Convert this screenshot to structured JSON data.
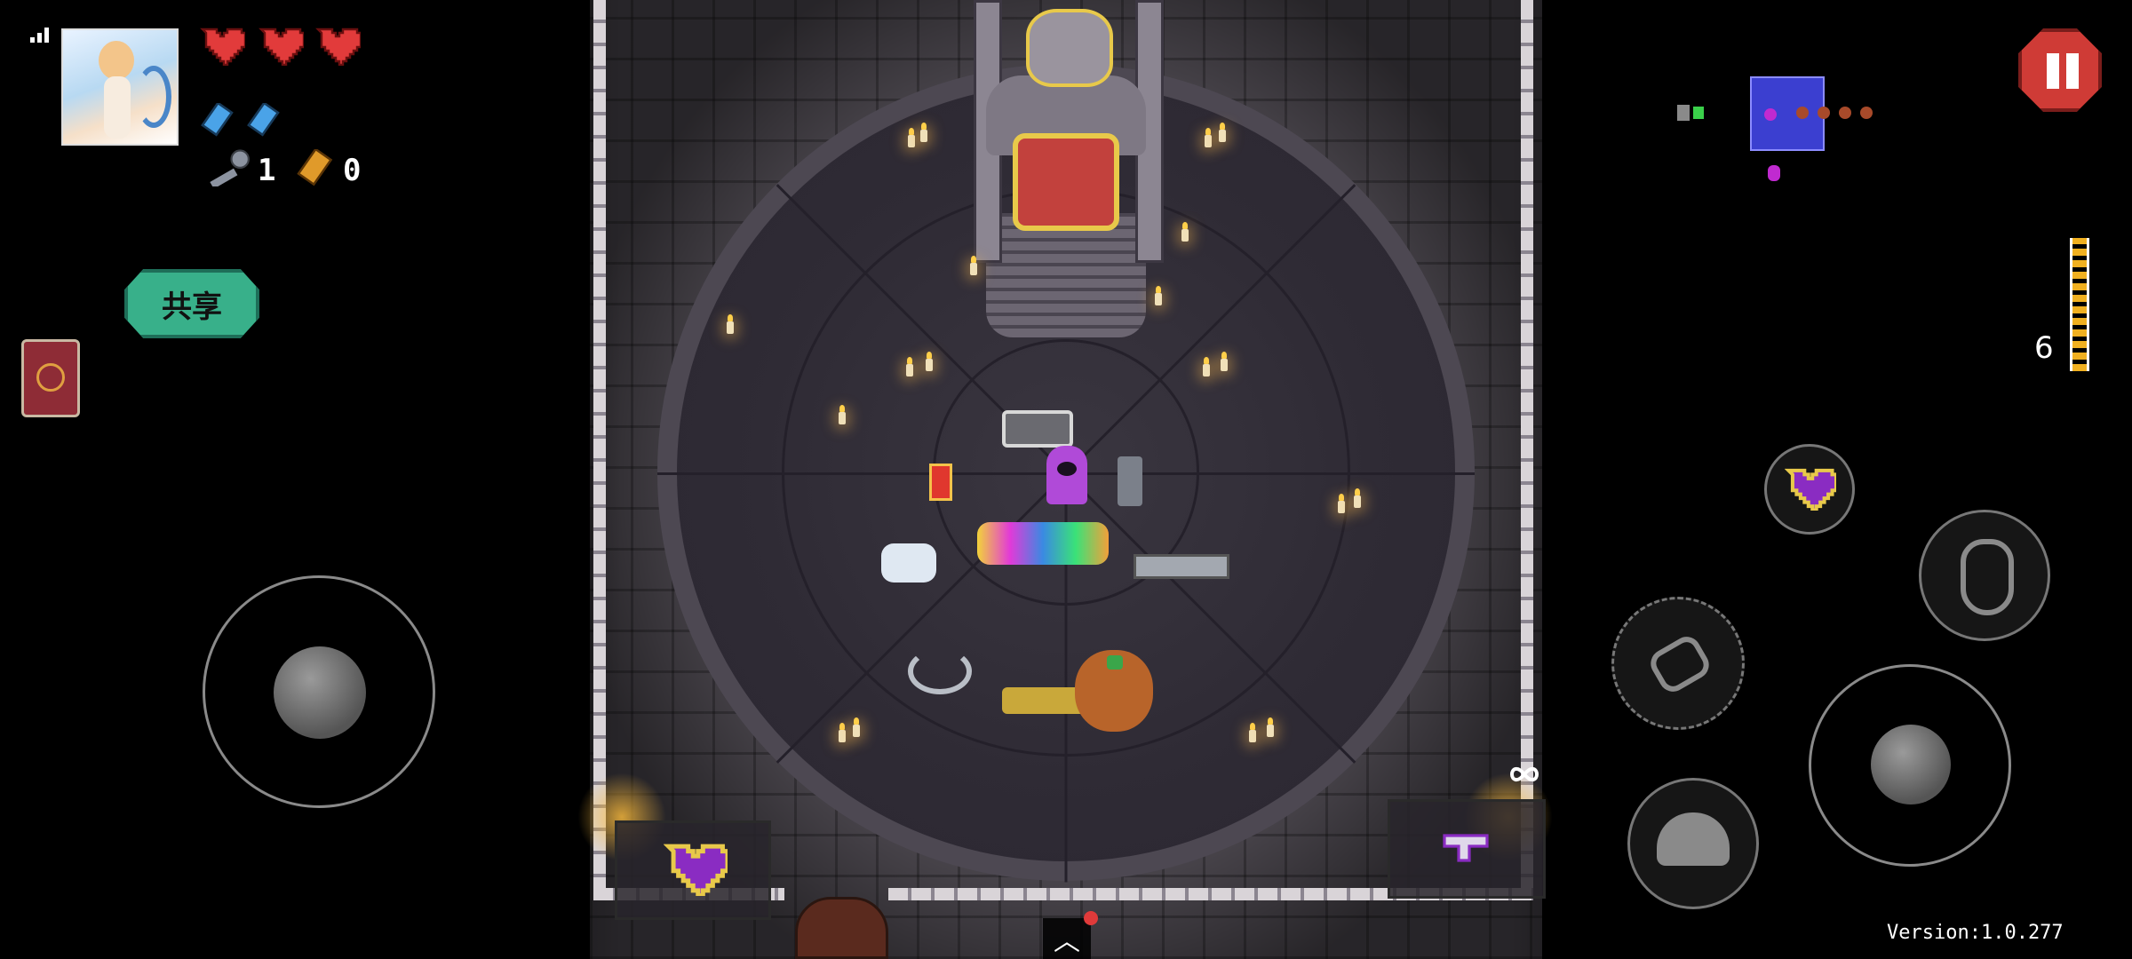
{
  "hud": {
    "hearts": 3,
    "blanks": 2,
    "keys": {
      "icon": "key-icon",
      "count": "1"
    },
    "shells": {
      "icon": "shell-currency-icon",
      "count": "0"
    },
    "share_label": "共享",
    "ammo_count": "6",
    "version": "Version:1.0.277"
  },
  "colors": {
    "heart": "#e23b3b",
    "blank": "#4aa3e8",
    "share_button": "#38b08a",
    "pause_button": "#cf3b36",
    "minimap_room": "#3b3fd0",
    "active_item_heart": "#8a2cc2"
  },
  "icons": {
    "avatar": "player-avatar",
    "book": "ammonomicon-book-icon",
    "pause": "pause-icon",
    "interact": "hand-icon",
    "dodge_roll": "dodge-roll-icon",
    "reload": "reload-icon",
    "active_item": "purple-heart-icon",
    "equipped_gun": "laser-gun-icon",
    "notification": "red-dot-icon",
    "expand": "chevron-up-icon"
  }
}
